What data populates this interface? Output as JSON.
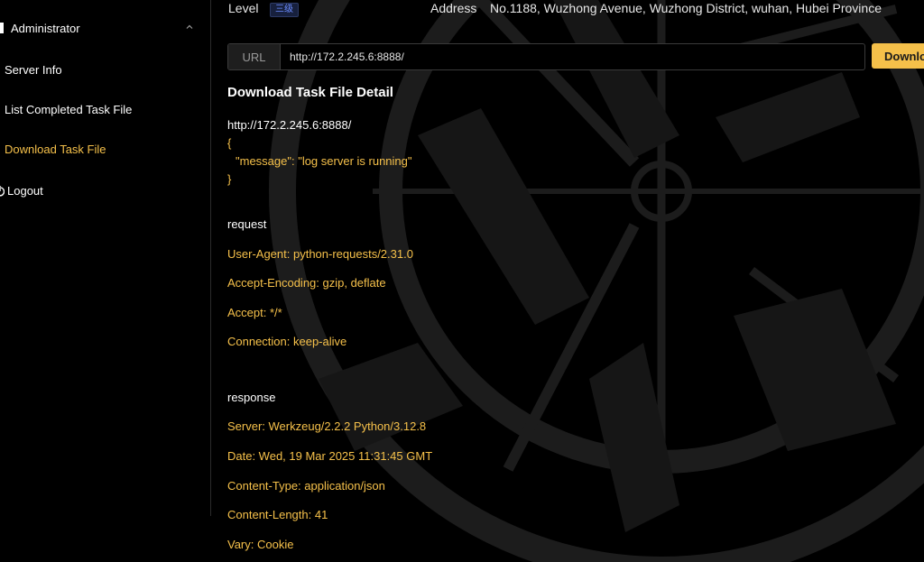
{
  "sidebar": {
    "group_label": "Administrator",
    "items": [
      {
        "label": "Server Info"
      },
      {
        "label": "List Completed Task File"
      },
      {
        "label": "Download Task File"
      }
    ],
    "logout_label": "Logout"
  },
  "header": {
    "level_label": "Level",
    "level_value": "三级",
    "address_label": "Address",
    "address_value": "No.1188, Wuzhong Avenue, Wuzhong District, wuhan, Hubei Province"
  },
  "url_bar": {
    "prefix": "URL",
    "value": "http://172.2.245.6:8888/",
    "button_label": "Download"
  },
  "detail": {
    "title": "Download Task File Detail",
    "url": "http://172.2.245.6:8888/",
    "body_lines": [
      "{",
      "\"message\": \"log server is running\"",
      "}"
    ],
    "request_heading": "request",
    "request_headers": [
      "User-Agent: python-requests/2.31.0",
      "Accept-Encoding: gzip, deflate",
      "Accept: */*",
      "Connection: keep-alive"
    ],
    "response_heading": "response",
    "response_headers": [
      "Server: Werkzeug/2.2.2 Python/3.12.8",
      "Date: Wed, 19 Mar 2025 11:31:45 GMT",
      "Content-Type: application/json",
      "Content-Length: 41",
      "Vary: Cookie"
    ]
  },
  "colors": {
    "accent": "#f5c04a",
    "background": "#000000",
    "text": "#ffffff"
  }
}
